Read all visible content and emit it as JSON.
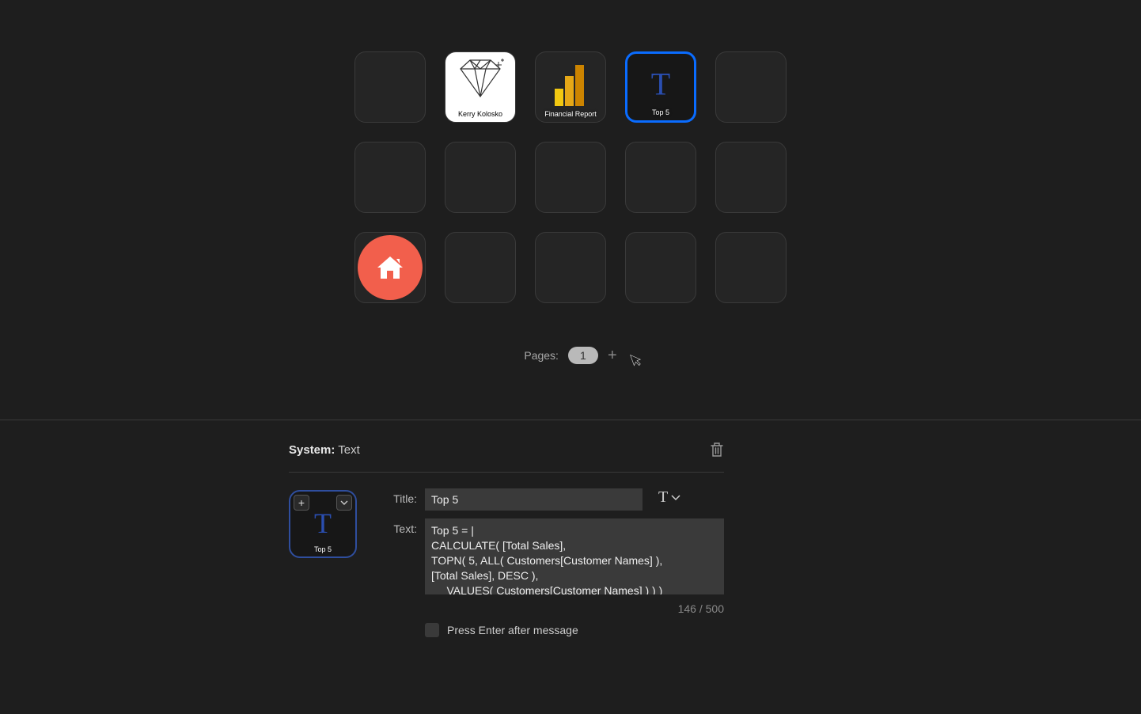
{
  "grid": {
    "tiles": [
      {
        "label": ""
      },
      {
        "label": "Kerry Kolosko",
        "type": "diamond"
      },
      {
        "label": "Financial Report",
        "type": "powerbi"
      },
      {
        "label": "Top 5",
        "type": "text",
        "selected": true
      },
      {
        "label": ""
      },
      {
        "label": ""
      },
      {
        "label": ""
      },
      {
        "label": ""
      },
      {
        "label": ""
      },
      {
        "label": ""
      },
      {
        "label": "",
        "type": "home"
      },
      {
        "label": ""
      },
      {
        "label": ""
      },
      {
        "label": ""
      },
      {
        "label": ""
      }
    ]
  },
  "pages": {
    "label": "Pages:",
    "current": "1"
  },
  "panel": {
    "system_label": "System:",
    "system_value": "Text",
    "title_label": "Title:",
    "title_value": "Top 5",
    "text_label": "Text:",
    "text_value": "Top 5 = |\nCALCULATE( [Total Sales],\nTOPN( 5, ALL( Customers[Customer Names] ),\n[Total Sales], DESC ),\n     VALUES( Customers[Customer Names] ) ) )",
    "preview_caption": "Top 5",
    "char_counter": "146 / 500",
    "checkbox_label": "Press Enter after message"
  }
}
